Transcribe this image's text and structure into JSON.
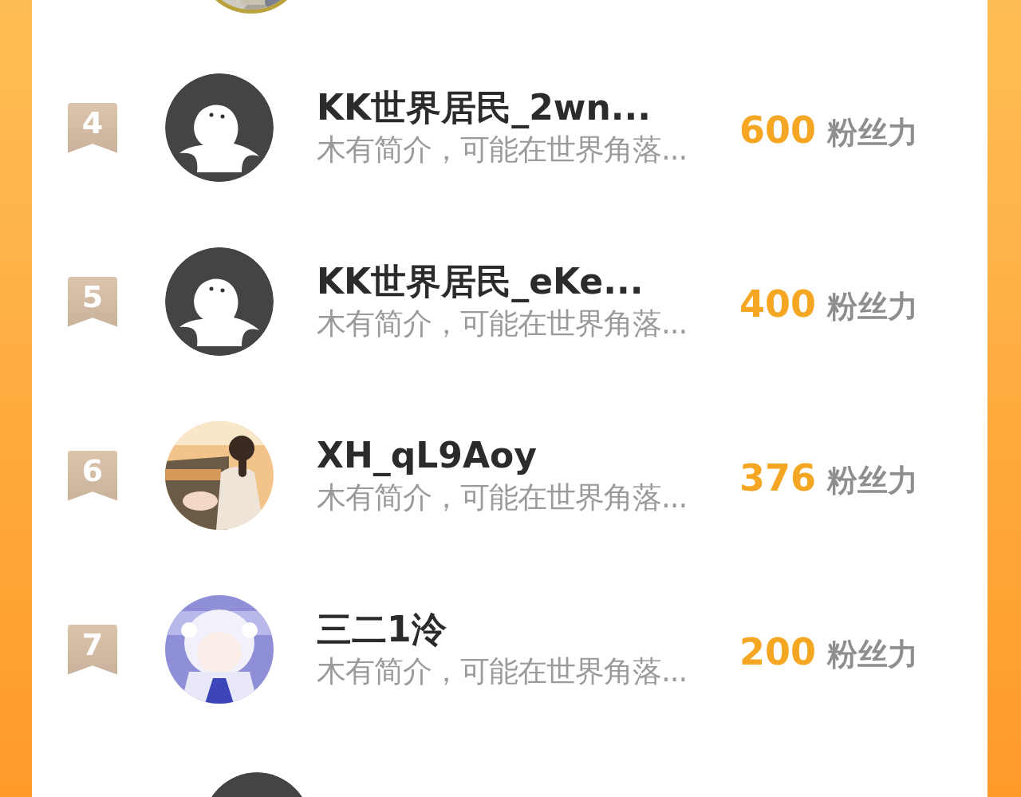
{
  "rows": [
    {
      "rank": "4",
      "avatar": {
        "kind": "default"
      },
      "name": "KK世界居民_2wn...",
      "bio": "木有简介，可能在世界角落...",
      "count": "600",
      "unit": "粉丝力"
    },
    {
      "rank": "5",
      "avatar": {
        "kind": "default"
      },
      "name": "KK世界居民_eKe...",
      "bio": "木有简介，可能在世界角落...",
      "count": "400",
      "unit": "粉丝力"
    },
    {
      "rank": "6",
      "name": "XH_qL9Aoy",
      "bio": "木有简介，可能在世界角落...",
      "count": "376",
      "unit": "粉丝力"
    },
    {
      "rank": "7",
      "name": "三二1泠",
      "bio": "木有简介，可能在世界角落...",
      "count": "200",
      "unit": "粉丝力"
    }
  ],
  "bottom_partial": {
    "avatar": {
      "kind": "default"
    }
  }
}
